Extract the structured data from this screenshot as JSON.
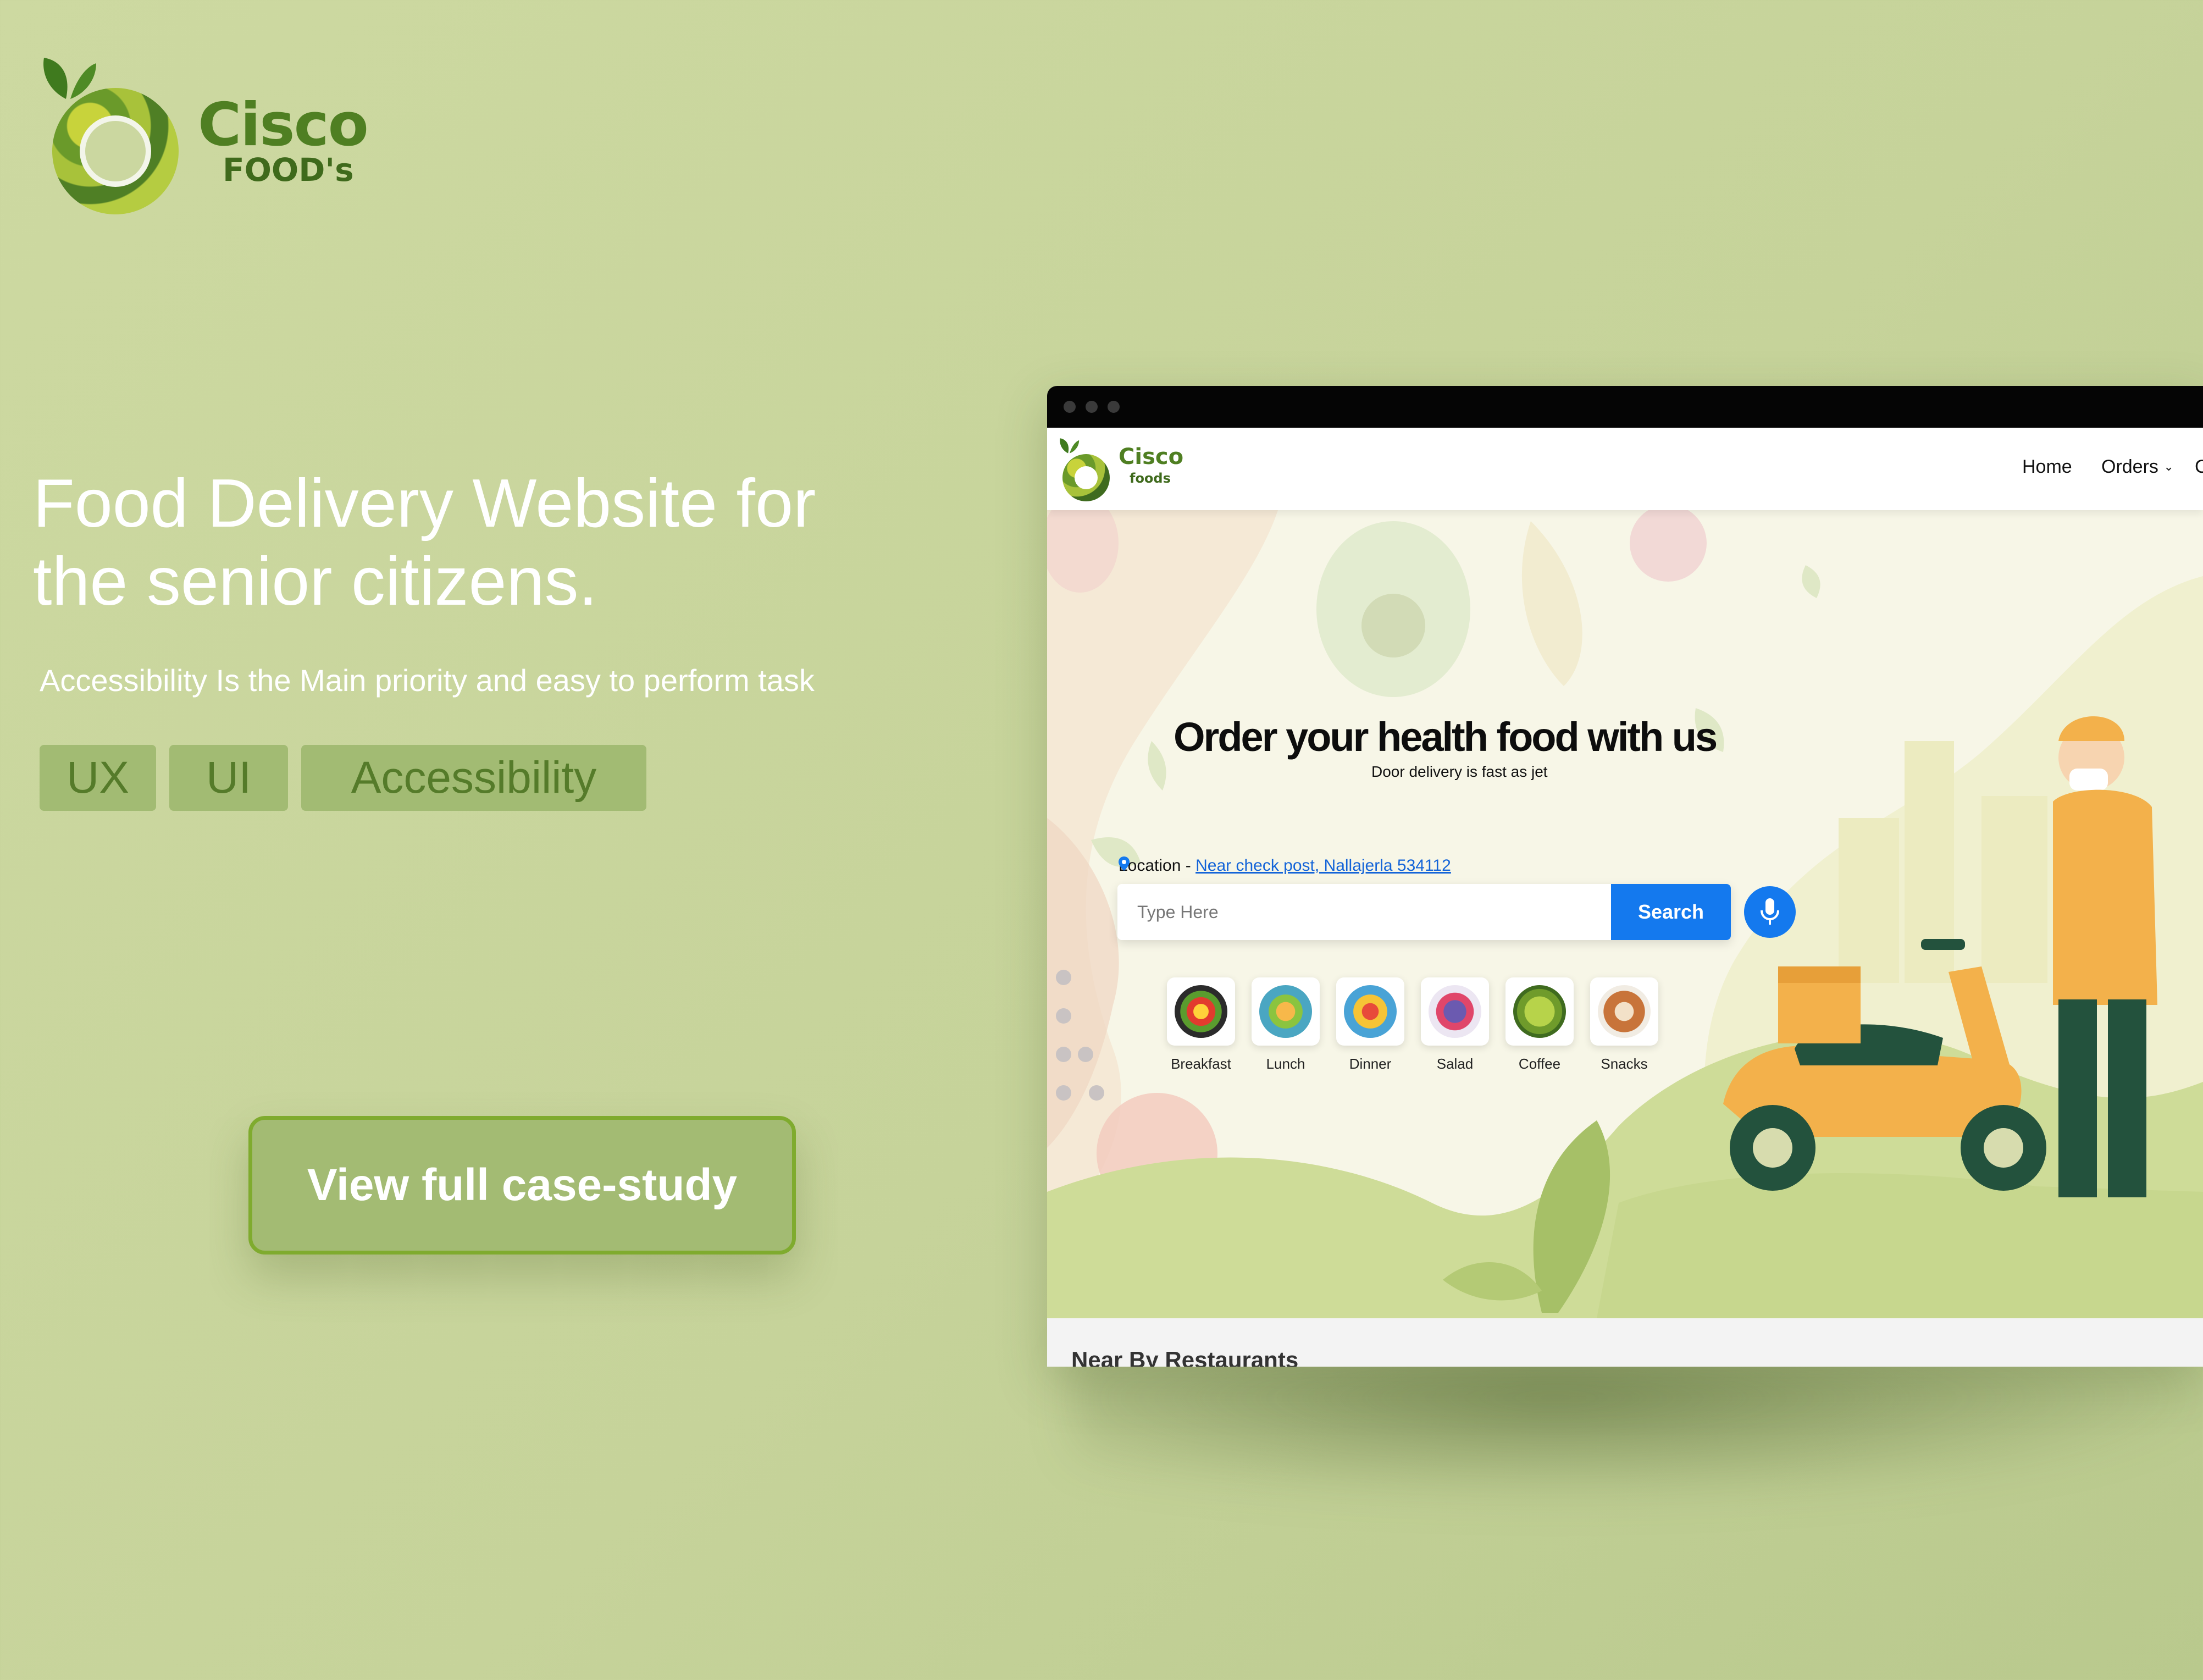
{
  "brand": {
    "name": "Cisco",
    "sub": "FOOD's"
  },
  "headline": {
    "line1": "Food Delivery Website for",
    "line2": "the senior citizens."
  },
  "subline": "Accessibility Is the Main priority and easy to perform task",
  "tags": [
    "UX",
    "UI",
    "Accessibility"
  ],
  "cta": "View full case-study",
  "site": {
    "logo": {
      "name": "Cisco",
      "sub": "foods"
    },
    "nav": [
      "Home",
      "Orders",
      "C"
    ],
    "hero": {
      "title": "Order your health food with us",
      "subtitle": "Door delivery is fast as jet"
    },
    "location": {
      "prefix": "Location - ",
      "value": "Near check post, Nallajerla 534112"
    },
    "search": {
      "placeholder": "Type Here",
      "button": "Search"
    },
    "categories": [
      "Breakfast",
      "Lunch",
      "Dinner",
      "Salad",
      "Coffee",
      "Snacks"
    ],
    "nearby_title": "Near By Restaurants"
  },
  "colors": {
    "background": "#cbd7a0",
    "brand_green": "#4f7f22",
    "accent_blue": "#1479ee",
    "scooter": "#f3b14b"
  },
  "icons": [
    "leaf-icon",
    "location-pin-icon",
    "microphone-icon",
    "chevron-down-icon"
  ]
}
